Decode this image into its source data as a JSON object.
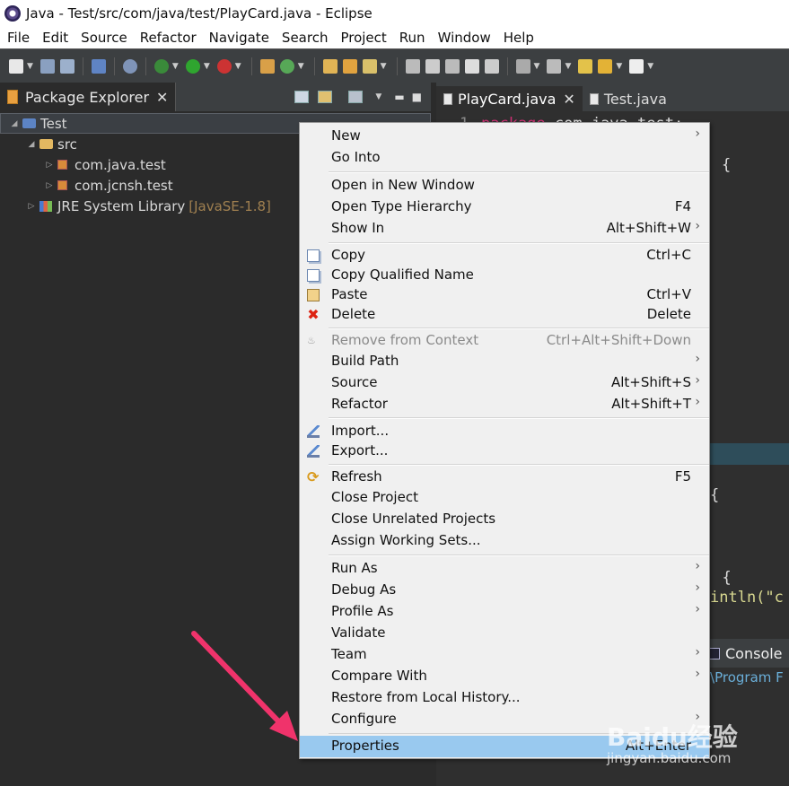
{
  "window": {
    "title": "Java - Test/src/com/java/test/PlayCard.java - Eclipse"
  },
  "menubar": [
    "File",
    "Edit",
    "Source",
    "Refactor",
    "Navigate",
    "Search",
    "Project",
    "Run",
    "Window",
    "Help"
  ],
  "package_explorer": {
    "tab_label": "Package Explorer",
    "tree": {
      "project": "Test",
      "src": "src",
      "package1": "com.java.test",
      "package2": "com.jcnsh.test",
      "library": "JRE System Library",
      "library_version": "[JavaSE-1.8]"
    }
  },
  "editor": {
    "tabs": [
      "PlayCard.java",
      "Test.java"
    ],
    "line_number": "1",
    "line1_keyword": "package",
    "line1_rest": " com.java.test;",
    "frag_brace1": "{",
    "frag_brace2": "{",
    "frag_paren": ") {",
    "frag_println": "intln(\"c"
  },
  "console": {
    "tab_label": "Console",
    "path": ":\\Program F"
  },
  "context_menu": {
    "new": "New",
    "go_into": "Go Into",
    "open_new_window": "Open in New Window",
    "open_type_hierarchy": "Open Type Hierarchy",
    "open_type_hierarchy_sc": "F4",
    "show_in": "Show In",
    "show_in_sc": "Alt+Shift+W",
    "copy": "Copy",
    "copy_sc": "Ctrl+C",
    "copy_qualified": "Copy Qualified Name",
    "paste": "Paste",
    "paste_sc": "Ctrl+V",
    "delete": "Delete",
    "delete_sc": "Delete",
    "remove_context": "Remove from Context",
    "remove_context_sc": "Ctrl+Alt+Shift+Down",
    "build_path": "Build Path",
    "source": "Source",
    "source_sc": "Alt+Shift+S",
    "refactor": "Refactor",
    "refactor_sc": "Alt+Shift+T",
    "import": "Import...",
    "export": "Export...",
    "refresh": "Refresh",
    "refresh_sc": "F5",
    "close_project": "Close Project",
    "close_unrelated": "Close Unrelated Projects",
    "assign_working_sets": "Assign Working Sets...",
    "run_as": "Run As",
    "debug_as": "Debug As",
    "profile_as": "Profile As",
    "validate": "Validate",
    "team": "Team",
    "compare_with": "Compare With",
    "restore_local": "Restore from Local History...",
    "configure": "Configure",
    "properties": "Properties",
    "properties_sc": "Alt+Enter",
    "submenu_arrow": "›"
  },
  "watermark": {
    "main": "Baidu经验",
    "sub": "jingyan.baidu.com"
  },
  "colors": {
    "menu_highlight": "#99c9ef",
    "arrow": "#f0336b",
    "keyword": "#cc2f73"
  }
}
